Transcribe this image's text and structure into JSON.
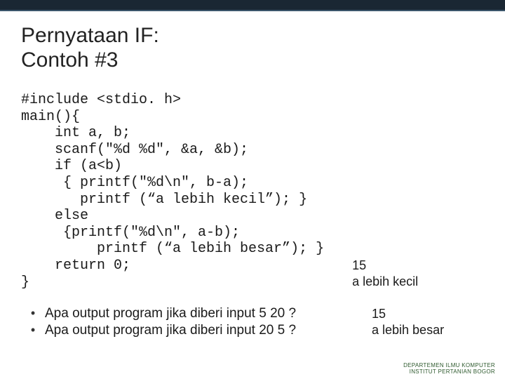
{
  "title": "Pernyataan IF:\nContoh #3",
  "code": {
    "l1": "#include <stdio. h>",
    "l2": "main(){",
    "l3": "    int a, b;",
    "l4": "    scanf(\"%d %d\", &a, &b);",
    "l5": "    if (a<b)",
    "l6": "     { printf(\"%d\\n\", b-a);",
    "l7": "       printf (“a lebih kecil”); }",
    "l8": "    else",
    "l9": "     {printf(\"%d\\n\", a-b);",
    "l10": "         printf (“a lebih besar”); }",
    "l11": "    return 0;",
    "l12": "}"
  },
  "output1": "15\na lebih kecil",
  "output2": "15\na lebih besar",
  "questions": {
    "q1": "Apa output program jika diberi input 5 20 ?",
    "q2": "Apa output program jika diberi input 20 5 ?"
  },
  "footer": {
    "line1": "DEPARTEMEN ILMU KOMPUTER",
    "line2": "INSTITUT PERTANIAN BOGOR"
  }
}
